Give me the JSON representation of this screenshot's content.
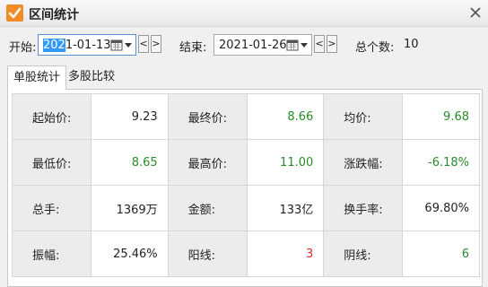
{
  "window": {
    "title": "区间统计"
  },
  "toolbar": {
    "start_label": "开始:",
    "start_date": {
      "selected": "202",
      "rest": "1-01-13"
    },
    "end_label": "结束:",
    "end_date": "2021-01-26",
    "prev_glyph": "<",
    "next_glyph": ">",
    "total_label": "总个数:",
    "total_value": "10"
  },
  "tabs": [
    {
      "label": "单股统计",
      "active": true
    },
    {
      "label": "多股比较",
      "active": false
    }
  ],
  "stats": [
    [
      {
        "label": "起始价:",
        "value": "9.23",
        "color": "#222222"
      },
      {
        "label": "最终价:",
        "value": "8.66",
        "color": "#2a8a2a"
      },
      {
        "label": "均价:",
        "value": "9.68",
        "color": "#2a8a2a"
      }
    ],
    [
      {
        "label": "最低价:",
        "value": "8.65",
        "color": "#2a8a2a"
      },
      {
        "label": "最高价:",
        "value": "11.00",
        "color": "#2a8a2a"
      },
      {
        "label": "涨跌幅:",
        "value": "-6.18%",
        "color": "#2a8a2a"
      }
    ],
    [
      {
        "label": "总手:",
        "value": "1369万",
        "color": "#222222"
      },
      {
        "label": "金额:",
        "value": "133亿",
        "color": "#222222"
      },
      {
        "label": "换手率:",
        "value": "69.80%",
        "color": "#222222"
      }
    ],
    [
      {
        "label": "振幅:",
        "value": "25.46%",
        "color": "#222222"
      },
      {
        "label": "阳线:",
        "value": "3",
        "color": "#d62b2b"
      },
      {
        "label": "阴线:",
        "value": "6",
        "color": "#2a8a2a"
      }
    ]
  ],
  "colors": {
    "accent": "#f08c28",
    "up": "#d62b2b",
    "down": "#2a8a2a",
    "selection": "#3399ff"
  }
}
